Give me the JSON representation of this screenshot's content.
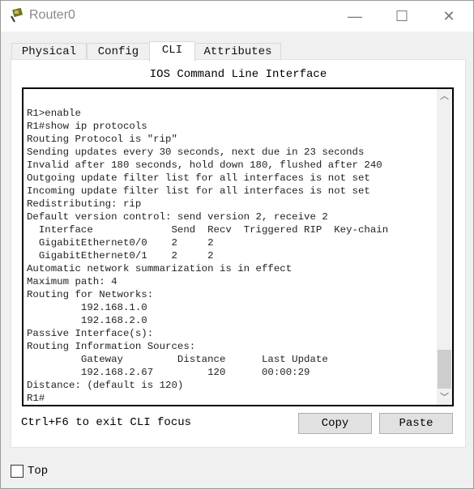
{
  "window": {
    "title": "Router0",
    "minimize": "—",
    "maximize": "☐",
    "close": "✕"
  },
  "tabs": [
    {
      "label": "Physical"
    },
    {
      "label": "Config"
    },
    {
      "label": "CLI",
      "active": true
    },
    {
      "label": "Attributes"
    }
  ],
  "cli": {
    "heading": "IOS Command Line Interface",
    "lines": [
      "R1>enable",
      "R1#show ip protocols",
      "Routing Protocol is \"rip\"",
      "Sending updates every 30 seconds, next due in 23 seconds",
      "Invalid after 180 seconds, hold down 180, flushed after 240",
      "Outgoing update filter list for all interfaces is not set",
      "Incoming update filter list for all interfaces is not set",
      "Redistributing: rip",
      "Default version control: send version 2, receive 2",
      "  Interface             Send  Recv  Triggered RIP  Key-chain",
      "  GigabitEthernet0/0    2     2",
      "  GigabitEthernet0/1    2     2",
      "Automatic network summarization is in effect",
      "Maximum path: 4",
      "Routing for Networks:",
      "         192.168.1.0",
      "         192.168.2.0",
      "Passive Interface(s):",
      "Routing Information Sources:",
      "         Gateway         Distance      Last Update",
      "         192.168.2.67         120      00:00:29",
      "Distance: (default is 120)",
      "R1#"
    ],
    "hint": "Ctrl+F6 to exit CLI focus",
    "copy": "Copy",
    "paste": "Paste"
  },
  "footer": {
    "top_label": "Top",
    "top_checked": false
  }
}
